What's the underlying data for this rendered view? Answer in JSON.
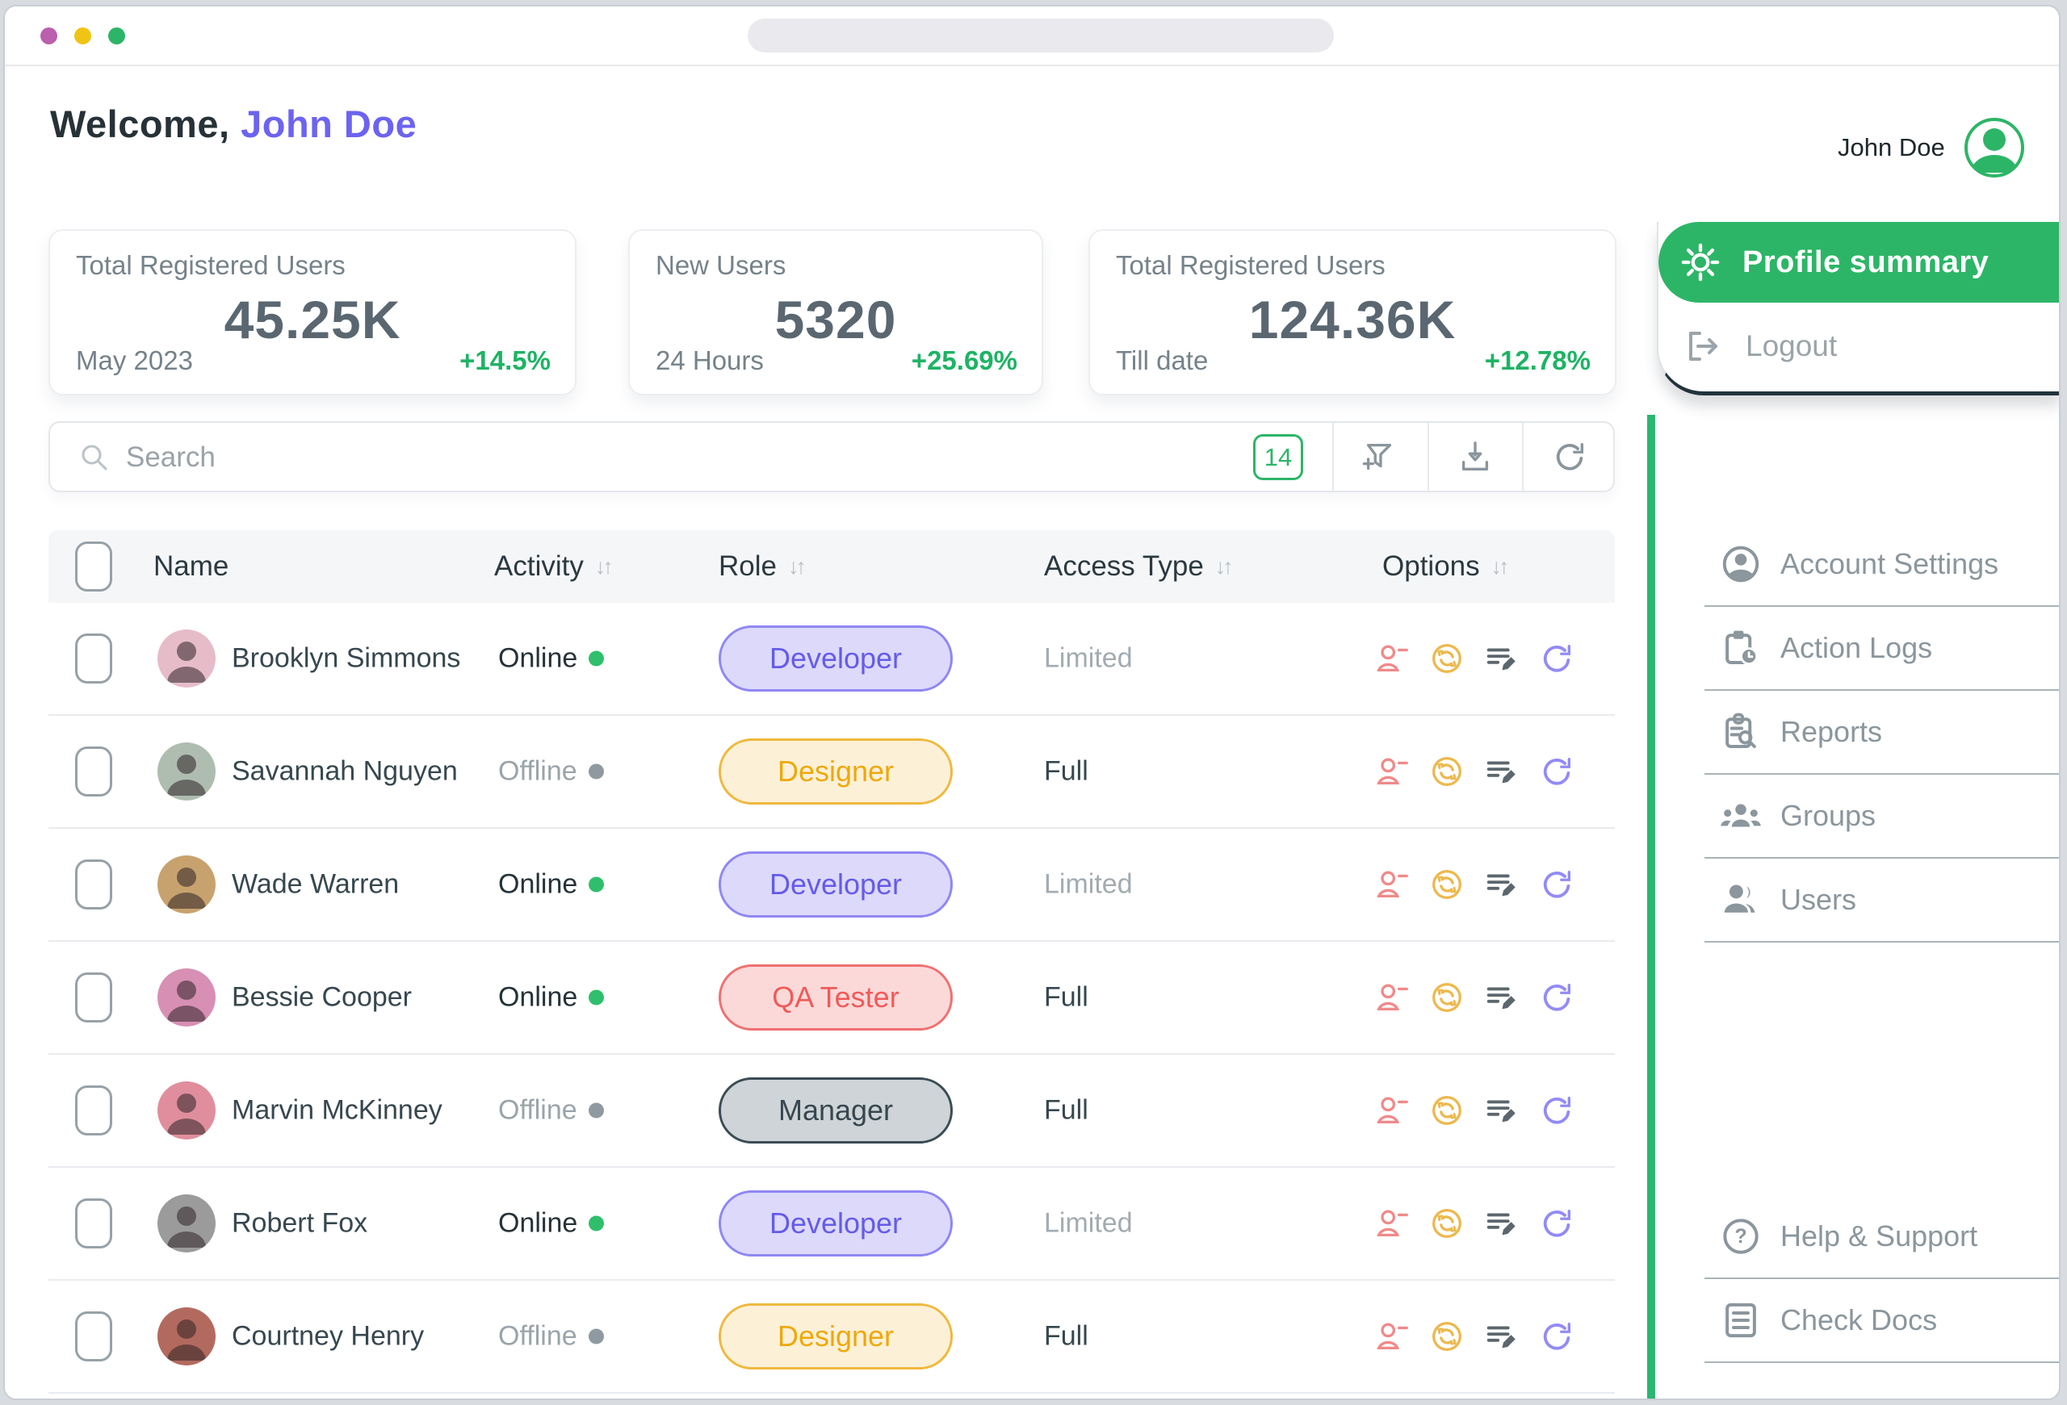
{
  "window": {
    "traffic_lights": [
      "purple",
      "yellow",
      "green"
    ],
    "address_bar": ""
  },
  "header": {
    "welcome_prefix": "Welcome, ",
    "welcome_name": "John Doe",
    "user_name": "John Doe"
  },
  "stats": [
    {
      "label": "Total Registered Users",
      "value": "45.25K",
      "period": "May 2023",
      "change": "+14.5%"
    },
    {
      "label": "New Users",
      "value": "5320",
      "period": "24 Hours",
      "change": "+25.69%"
    },
    {
      "label": "Total Registered Users",
      "value": "124.36K",
      "period": "Till date",
      "change": "+12.78%"
    }
  ],
  "toolbar": {
    "search_placeholder": "Search",
    "search_value": "",
    "count_badge": "14"
  },
  "table": {
    "columns": [
      {
        "label": "Name",
        "sortable": false
      },
      {
        "label": "Activity",
        "sortable": true
      },
      {
        "label": "Role",
        "sortable": true
      },
      {
        "label": "Access Type",
        "sortable": true
      },
      {
        "label": "Options",
        "sortable": true
      }
    ],
    "sort_glyph": "↓↑",
    "rows": [
      {
        "name": "Brooklyn Simmons",
        "activity": "Online",
        "online": true,
        "role": "Developer",
        "variant": "purple",
        "access": "Limited",
        "avatar_color": "#e7bcc9"
      },
      {
        "name": "Savannah Nguyen",
        "activity": "Offline",
        "online": false,
        "role": "Designer",
        "variant": "yellow",
        "access": "Full",
        "avatar_color": "#aebdb0"
      },
      {
        "name": "Wade Warren",
        "activity": "Online",
        "online": true,
        "role": "Developer",
        "variant": "purple",
        "access": "Limited",
        "avatar_color": "#c8a26e"
      },
      {
        "name": "Bessie Cooper",
        "activity": "Online",
        "online": true,
        "role": "QA Tester",
        "variant": "red",
        "access": "Full",
        "avatar_color": "#d88fb4"
      },
      {
        "name": "Marvin McKinney",
        "activity": "Offline",
        "online": false,
        "role": "Manager",
        "variant": "gray",
        "access": "Full",
        "avatar_color": "#e08e9d"
      },
      {
        "name": "Robert Fox",
        "activity": "Online",
        "online": true,
        "role": "Developer",
        "variant": "purple",
        "access": "Limited",
        "avatar_color": "#9b9b9b"
      },
      {
        "name": "Courtney Henry",
        "activity": "Offline",
        "online": false,
        "role": "Designer",
        "variant": "yellow",
        "access": "Full",
        "avatar_color": "#b36a5e"
      }
    ]
  },
  "sidebar": {
    "profile_button": "Profile summary",
    "logout": "Logout",
    "menu": [
      {
        "label": "Account Settings",
        "icon": "user-circle-icon"
      },
      {
        "label": "Action Logs",
        "icon": "clipboard-clock-icon"
      },
      {
        "label": "Reports",
        "icon": "clipboard-search-icon"
      },
      {
        "label": "Groups",
        "icon": "groups-icon"
      },
      {
        "label": "Users",
        "icon": "users-icon"
      }
    ],
    "footer_menu": [
      {
        "label": "Help & Support",
        "icon": "help-circle-icon"
      },
      {
        "label": "Check Docs",
        "icon": "document-icon"
      }
    ]
  },
  "icons": {
    "search": "magnifier",
    "filter_add": "funnel-plus",
    "export": "download-tray",
    "refresh": "circular-arrow",
    "profile": "gear",
    "logout": "door-arrow",
    "row_options": [
      "remove-user",
      "sync-circle",
      "edit-list",
      "reload"
    ]
  },
  "colors": {
    "accent_green": "#2db567",
    "accent_purple": "#6c63f0",
    "positive": "#1eb364",
    "online_dot": "#2fbf6c",
    "offline_dot": "#8f9aa0",
    "role_developer": "#655be8",
    "role_designer": "#eda90b",
    "role_qa": "#f05a5a",
    "role_manager": "#37474f"
  }
}
